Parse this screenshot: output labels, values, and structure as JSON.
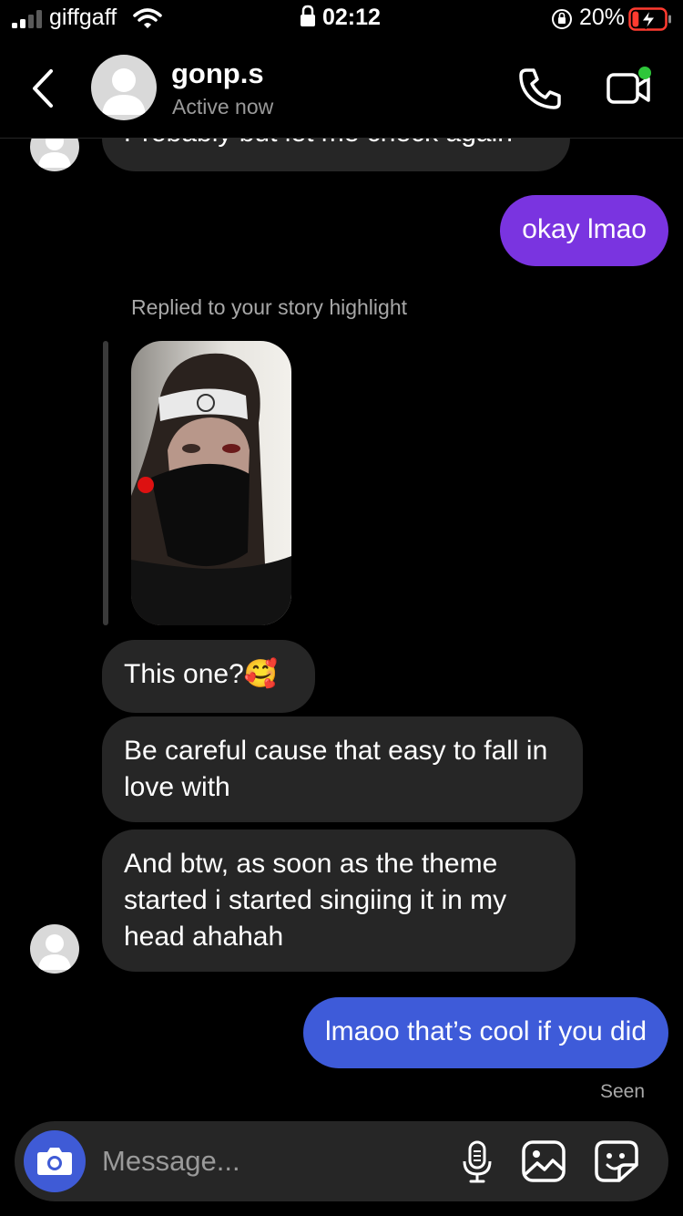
{
  "status_bar": {
    "carrier": "giffgaff",
    "time": "02:12",
    "battery_percent": "20%",
    "battery_level": 0.2
  },
  "header": {
    "username": "gonp.s",
    "status": "Active now"
  },
  "messages": {
    "partial_incoming": "Probably but let me check again",
    "out_1": "okay lmao",
    "reply_label": "Replied to your story highlight",
    "in_1": "This one?🥰",
    "in_2": "Be careful cause that easy to fall in love with",
    "in_3": "And btw, as soon as the theme started i started singiing it in my head ahahah",
    "out_2": "lmaoo that’s cool if you did",
    "seen": "Seen"
  },
  "composer": {
    "placeholder": "Message..."
  },
  "colors": {
    "out_bubble_purple": "#7a34e0",
    "out_bubble_blue": "#3e5bd9",
    "in_bubble": "#262626",
    "active_dot": "#2ec73a",
    "battery_charging": "#ff3b30"
  }
}
